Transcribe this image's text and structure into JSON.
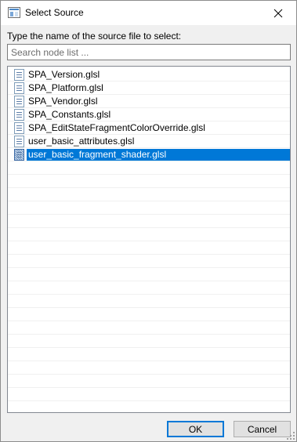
{
  "window": {
    "title": "Select Source",
    "icon": "window-app-icon",
    "close_icon": "close-icon"
  },
  "prompt": "Type the name of the source file to select:",
  "search": {
    "placeholder": "Search node list ...",
    "value": ""
  },
  "files": [
    {
      "name": "SPA_Version.glsl",
      "selected": false
    },
    {
      "name": "SPA_Platform.glsl",
      "selected": false
    },
    {
      "name": "SPA_Vendor.glsl",
      "selected": false
    },
    {
      "name": "SPA_Constants.glsl",
      "selected": false
    },
    {
      "name": "SPA_EditStateFragmentColorOverride.glsl",
      "selected": false
    },
    {
      "name": "user_basic_attributes.glsl",
      "selected": false
    },
    {
      "name": "user_basic_fragment_shader.glsl",
      "selected": true
    }
  ],
  "buttons": {
    "ok": "OK",
    "cancel": "Cancel"
  },
  "colors": {
    "selection": "#0078d7",
    "selection_text": "#ffffff"
  }
}
